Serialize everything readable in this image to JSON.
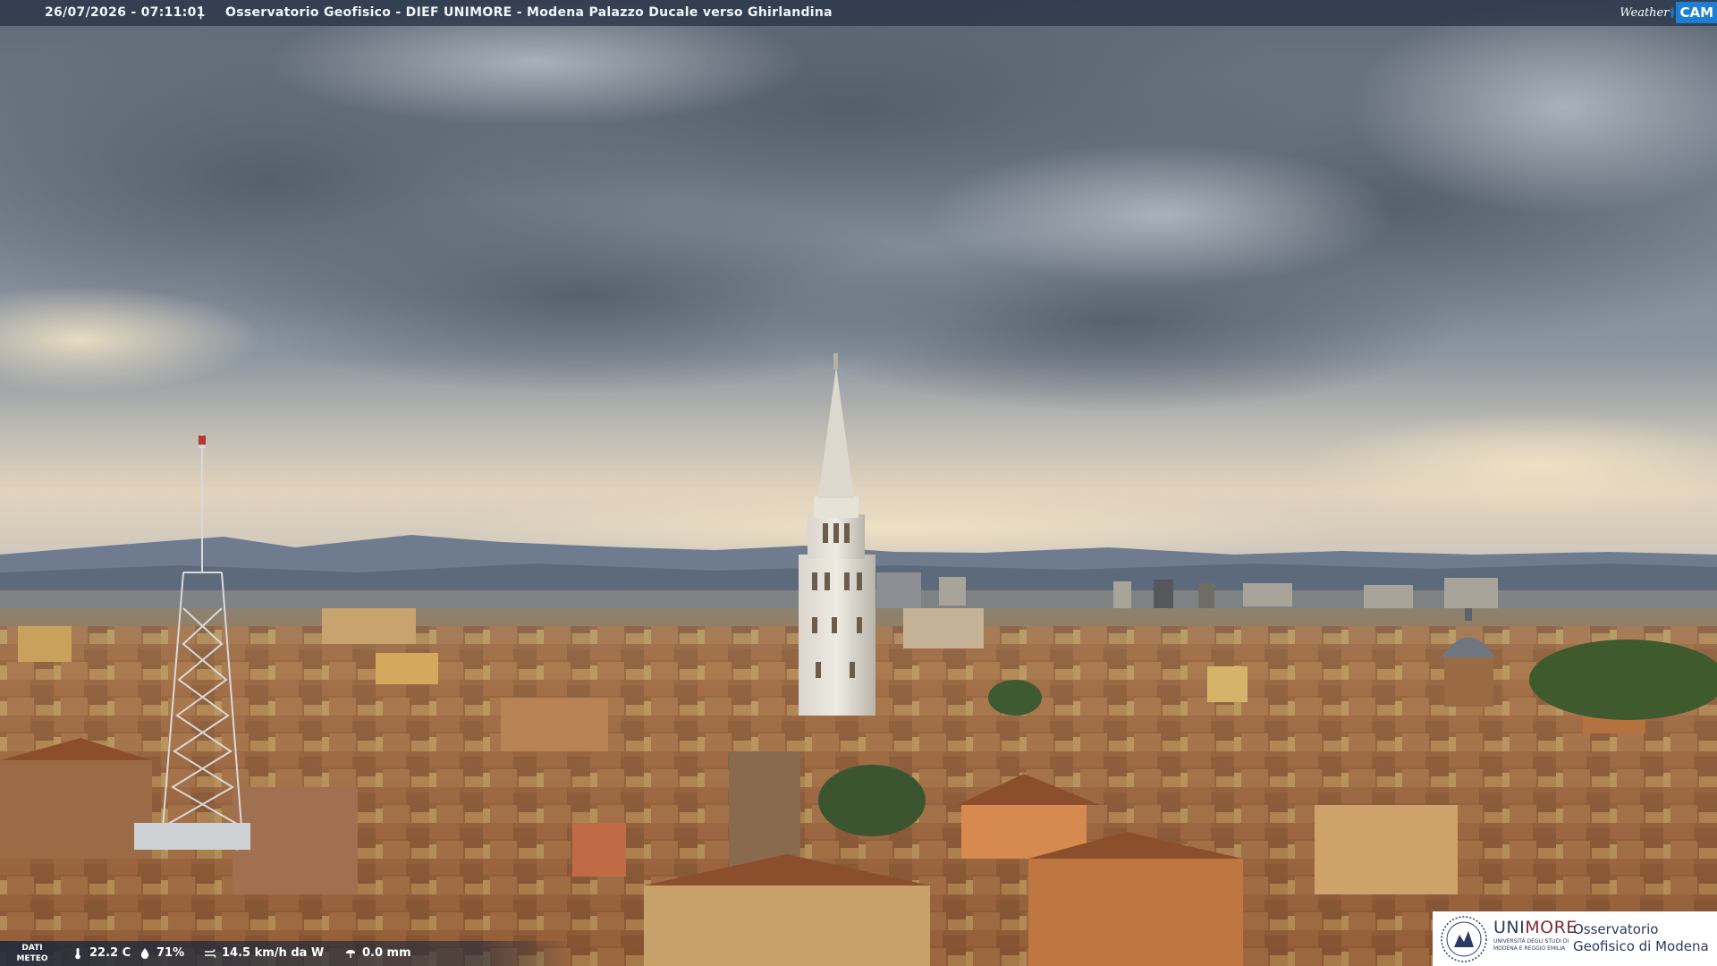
{
  "overlay": {
    "timestamp": "26/07/2026 - 07:11:01",
    "separator": "|",
    "caption": "Osservatorio Geofisico - DIEF UNIMORE - Modena Palazzo Ducale verso Ghirlandina"
  },
  "brand": {
    "weather_text": "Weather",
    "cam_text": "CAM",
    "accent": "#1b7fd6"
  },
  "meteo": {
    "label": "DATI METEO",
    "temperature": "22.2 C",
    "humidity": "71%",
    "wind": "14.5 km/h da W",
    "rain": "0.0 mm"
  },
  "unimore": {
    "name_part1": "UNI",
    "name_part2": "MORE",
    "university_line": "UNIVERSITÀ DEGLI STUDI DI MODENA E REGGIO EMILIA",
    "observatory": "Osservatorio Geofisico di Modena"
  }
}
